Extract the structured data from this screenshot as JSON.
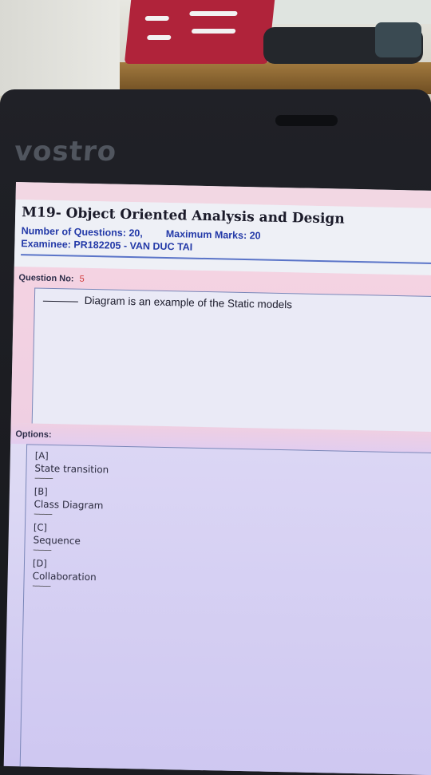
{
  "laptop": {
    "brand": "vostro"
  },
  "exam": {
    "title": "M19- Object Oriented Analysis and Design",
    "num_questions_label": "Number of Questions:",
    "num_questions_value": "20,",
    "max_marks_label": "Maximum Marks:",
    "max_marks_value": "20",
    "examinee_label": "Examinee:",
    "examinee_value": "PR182205 - VAN DUC TAI"
  },
  "question": {
    "no_label": "Question No:",
    "no_value": "5",
    "text": "Diagram is an example of the Static models"
  },
  "options": {
    "label": "Options:",
    "items": [
      {
        "letter": "[A]",
        "text": "State transition",
        "sep": "----------"
      },
      {
        "letter": "[B]",
        "text": "Class Diagram",
        "sep": "----------"
      },
      {
        "letter": "[C]",
        "text": "Sequence",
        "sep": "----------"
      },
      {
        "letter": "[D]",
        "text": "Collaboration",
        "sep": "----------"
      }
    ]
  },
  "colors": {
    "header_blue": "#243aa8",
    "question_number_red": "#d13838",
    "pink_band": "#f4d3e2",
    "screen_lavender": "#dcd8f4"
  }
}
